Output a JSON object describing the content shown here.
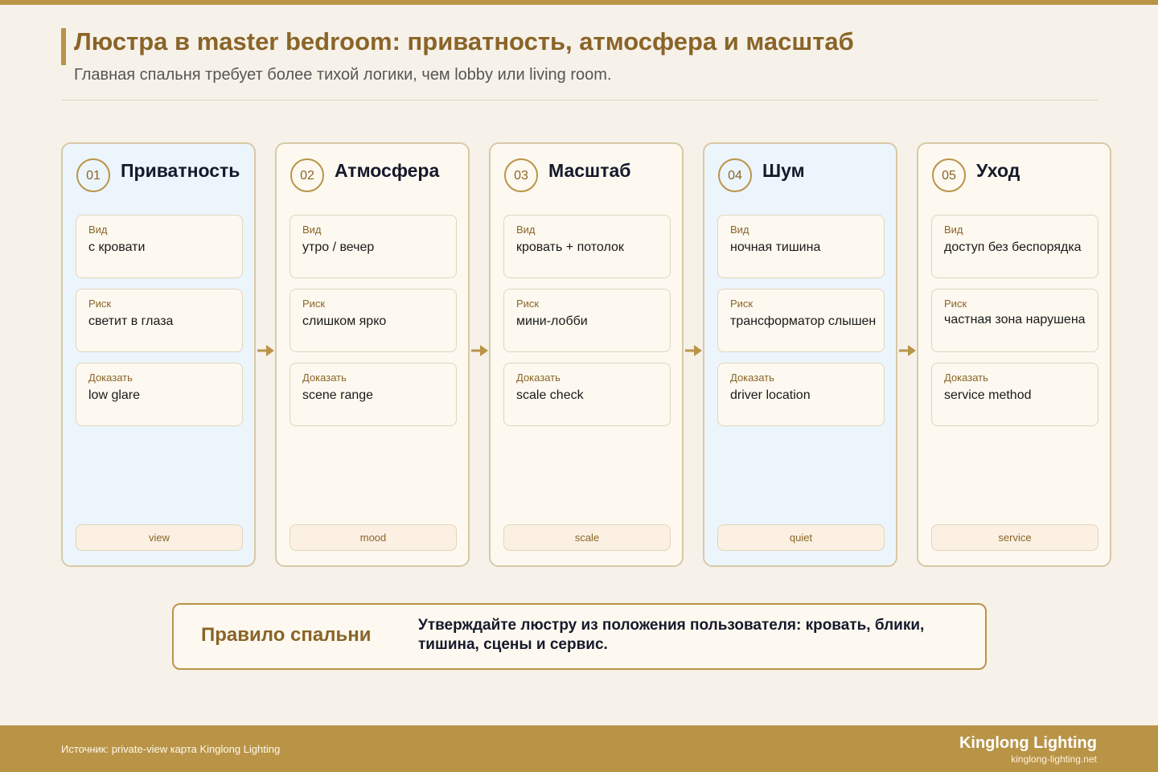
{
  "header": {
    "title": "Люстра в master bedroom: приватность, атмосфера и масштаб",
    "subtitle": "Главная спальня требует более тихой логики, чем lobby или living room."
  },
  "colors": {
    "accent": "#b99447",
    "title": "#8a6428",
    "card_blue": "#ecf5fc",
    "card_cream": "#fdf9f0",
    "background": "#f6f2ea"
  },
  "cards": [
    {
      "num": "01",
      "title": "Приватность",
      "tint": "blue",
      "fields": [
        {
          "label": "Вид",
          "value": "с кровати"
        },
        {
          "label": "Риск",
          "value": "светит в глаза"
        },
        {
          "label": "Доказать",
          "value": "low glare"
        }
      ],
      "tag": "view"
    },
    {
      "num": "02",
      "title": "Атмосфера",
      "tint": "cream",
      "fields": [
        {
          "label": "Вид",
          "value": "утро / вечер"
        },
        {
          "label": "Риск",
          "value": "слишком ярко"
        },
        {
          "label": "Доказать",
          "value": "scene range"
        }
      ],
      "tag": "mood"
    },
    {
      "num": "03",
      "title": "Масштаб",
      "tint": "cream",
      "fields": [
        {
          "label": "Вид",
          "value": "кровать + потолок"
        },
        {
          "label": "Риск",
          "value": "мини-лобби"
        },
        {
          "label": "Доказать",
          "value": "scale check"
        }
      ],
      "tag": "scale"
    },
    {
      "num": "04",
      "title": "Шум",
      "tint": "blue",
      "fields": [
        {
          "label": "Вид",
          "value": "ночная тишина"
        },
        {
          "label": "Риск",
          "value": "трансформатор слышен"
        },
        {
          "label": "Доказать",
          "value": "driver location"
        }
      ],
      "tag": "quiet"
    },
    {
      "num": "05",
      "title": "Уход",
      "tint": "cream",
      "fields": [
        {
          "label": "Вид",
          "value": "доступ без беспорядка"
        },
        {
          "label": "Риск",
          "value": "частная зона нарушена"
        },
        {
          "label": "Доказать",
          "value": "service method"
        }
      ],
      "tag": "service"
    }
  ],
  "rule": {
    "title": "Правило спальни",
    "text": "Утверждайте люстру из положения пользователя: кровать, блики, тишина, сцены и сервис."
  },
  "footer": {
    "source": "Источник: private-view карта Kinglong Lighting",
    "brand": "Kinglong Lighting",
    "site": "kinglong-lighting.net"
  }
}
